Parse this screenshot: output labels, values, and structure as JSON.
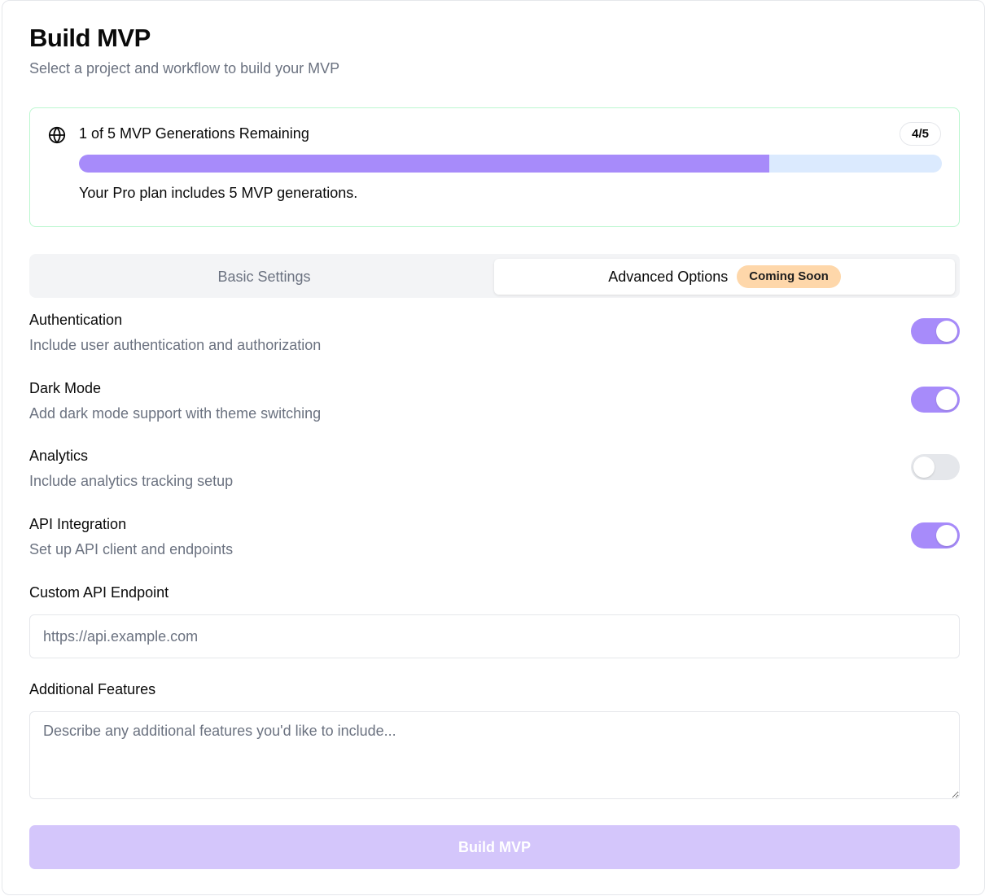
{
  "header": {
    "title": "Build MVP",
    "subtitle": "Select a project and workflow to build your MVP"
  },
  "usage": {
    "icon": "globe-icon",
    "title": "1 of 5 MVP Generations Remaining",
    "badge": "4/5",
    "progress_fraction": 0.8,
    "note": "Your Pro plan includes 5 MVP generations."
  },
  "tabs": [
    {
      "label": "Basic Settings",
      "active": false
    },
    {
      "label": "Advanced Options",
      "active": true,
      "badge": "Coming Soon"
    }
  ],
  "options": [
    {
      "title": "Authentication",
      "description": "Include user authentication and authorization",
      "enabled": true
    },
    {
      "title": "Dark Mode",
      "description": "Add dark mode support with theme switching",
      "enabled": true
    },
    {
      "title": "Analytics",
      "description": "Include analytics tracking setup",
      "enabled": false
    },
    {
      "title": "API Integration",
      "description": "Set up API client and endpoints",
      "enabled": true
    }
  ],
  "custom_endpoint": {
    "label": "Custom API Endpoint",
    "value": "",
    "placeholder": "https://api.example.com"
  },
  "additional_features": {
    "label": "Additional Features",
    "value": "",
    "placeholder": "Describe any additional features you'd like to include..."
  },
  "build_button": {
    "label": "Build MVP"
  },
  "colors": {
    "accent": "#a78bfa",
    "accent_disabled": "#d4c6fb",
    "progress_track": "#dbeafe",
    "usage_border": "#bbf7d0",
    "badge_soon": "#fed7aa",
    "muted_text": "#6b7280"
  }
}
